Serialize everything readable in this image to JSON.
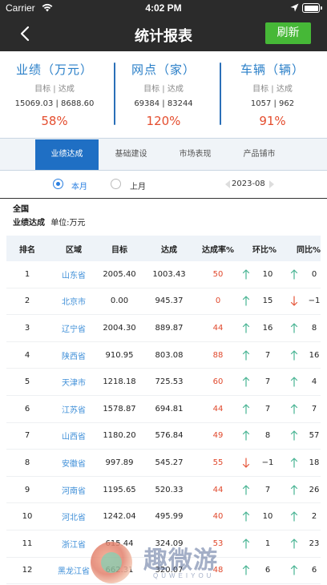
{
  "status_bar": {
    "carrier": "Carrier",
    "time": "4:02 PM"
  },
  "navbar": {
    "title": "统计报表",
    "refresh_label": "刷新"
  },
  "summary": [
    {
      "title": "业绩（万元）",
      "sub": "目标 | 达成",
      "values": "15069.03 | 8688.60",
      "pct": "58%"
    },
    {
      "title": "网点（家）",
      "sub": "目标 | 达成",
      "values": "69384 | 83244",
      "pct": "120%"
    },
    {
      "title": "车辆（辆）",
      "sub": "目标 | 达成",
      "values": "1057 | 962",
      "pct": "91%"
    }
  ],
  "tabs": [
    {
      "label": "业绩达成",
      "active": true
    },
    {
      "label": "基础建设",
      "active": false
    },
    {
      "label": "市场表现",
      "active": false
    },
    {
      "label": "产品铺市",
      "active": false
    }
  ],
  "period": {
    "option_month": "本月",
    "option_last": "上月",
    "selected": "本月",
    "date": "2023-08"
  },
  "region": "全国",
  "section": {
    "title": "业绩达成",
    "unit": "单位:万元"
  },
  "table": {
    "headers": {
      "rank": "排名",
      "area": "区域",
      "target": "目标",
      "done": "达成",
      "rate": "达成率%",
      "hb": "环比%",
      "tb": "同比%"
    },
    "rows": [
      {
        "rank": "1",
        "area": "山东省",
        "target": "2005.40",
        "done": "1003.43",
        "rate": "50",
        "hb_dir": "up",
        "hb": "10",
        "tb_dir": "up",
        "tb": "0"
      },
      {
        "rank": "2",
        "area": "北京市",
        "target": "0.00",
        "done": "945.37",
        "rate": "0",
        "hb_dir": "up",
        "hb": "15",
        "tb_dir": "down",
        "tb": "−1"
      },
      {
        "rank": "3",
        "area": "辽宁省",
        "target": "2004.30",
        "done": "889.87",
        "rate": "44",
        "hb_dir": "up",
        "hb": "16",
        "tb_dir": "up",
        "tb": "8"
      },
      {
        "rank": "4",
        "area": "陕西省",
        "target": "910.95",
        "done": "803.08",
        "rate": "88",
        "hb_dir": "up",
        "hb": "7",
        "tb_dir": "up",
        "tb": "16"
      },
      {
        "rank": "5",
        "area": "天津市",
        "target": "1218.18",
        "done": "725.53",
        "rate": "60",
        "hb_dir": "up",
        "hb": "7",
        "tb_dir": "up",
        "tb": "4"
      },
      {
        "rank": "6",
        "area": "江苏省",
        "target": "1578.87",
        "done": "694.81",
        "rate": "44",
        "hb_dir": "up",
        "hb": "7",
        "tb_dir": "up",
        "tb": "7"
      },
      {
        "rank": "7",
        "area": "山西省",
        "target": "1180.20",
        "done": "576.84",
        "rate": "49",
        "hb_dir": "up",
        "hb": "8",
        "tb_dir": "up",
        "tb": "57"
      },
      {
        "rank": "8",
        "area": "安徽省",
        "target": "997.89",
        "done": "545.27",
        "rate": "55",
        "hb_dir": "down",
        "hb": "−1",
        "tb_dir": "up",
        "tb": "18"
      },
      {
        "rank": "9",
        "area": "河南省",
        "target": "1195.65",
        "done": "520.33",
        "rate": "44",
        "hb_dir": "up",
        "hb": "7",
        "tb_dir": "up",
        "tb": "26"
      },
      {
        "rank": "10",
        "area": "河北省",
        "target": "1242.04",
        "done": "495.99",
        "rate": "40",
        "hb_dir": "up",
        "hb": "10",
        "tb_dir": "up",
        "tb": "2"
      },
      {
        "rank": "11",
        "area": "浙江省",
        "target": "615.44",
        "done": "324.09",
        "rate": "53",
        "hb_dir": "up",
        "hb": "1",
        "tb_dir": "up",
        "tb": "23"
      },
      {
        "rank": "12",
        "area": "黑龙江省",
        "target": "662.31",
        "done": "320.07",
        "rate": "48",
        "hb_dir": "up",
        "hb": "6",
        "tb_dir": "up",
        "tb": "6"
      }
    ]
  },
  "watermark": {
    "text": "趣微游",
    "sub": "QUWEIYOU"
  },
  "colors": {
    "accent_blue": "#1f6fc4",
    "refresh_green": "#46b837",
    "rate_red": "#e0482c",
    "arrow_up_green": "#47b392",
    "arrow_down_red": "#e5563a"
  }
}
